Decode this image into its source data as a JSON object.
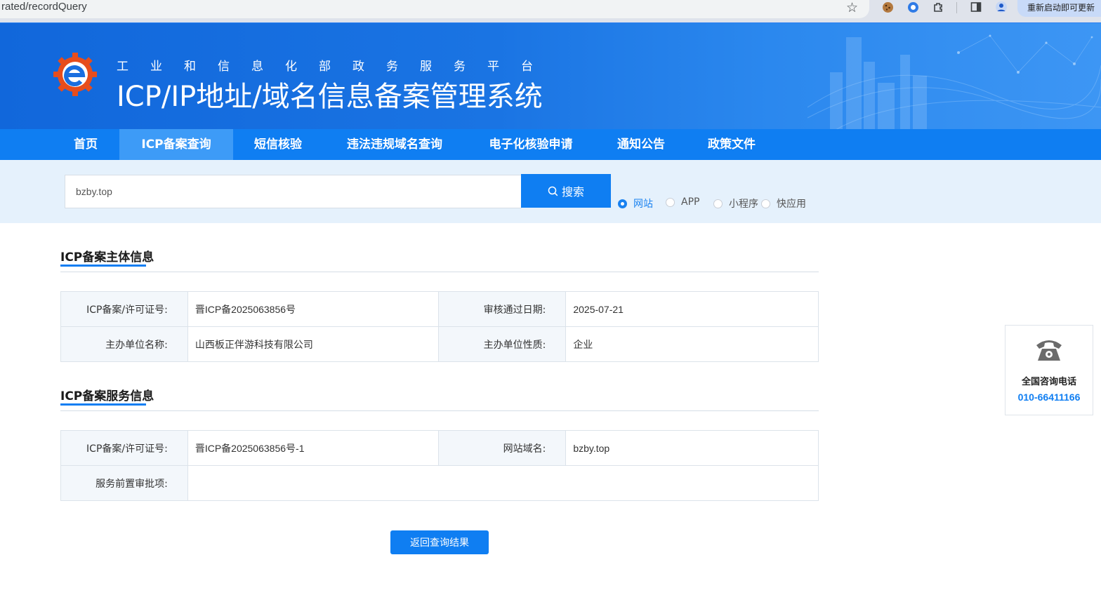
{
  "browser": {
    "url_text": "rated/recordQuery",
    "restart_label": "重新启动即可更新"
  },
  "header": {
    "subtitle": "工业和信息化部政务服务平台",
    "title": "ICP/IP地址/域名信息备案管理系统"
  },
  "nav": {
    "items": [
      {
        "label": "首页"
      },
      {
        "label": "ICP备案查询"
      },
      {
        "label": "短信核验"
      },
      {
        "label": "违法违规域名查询"
      },
      {
        "label": "电子化核验申请"
      },
      {
        "label": "通知公告"
      },
      {
        "label": "政策文件"
      }
    ],
    "active_index": 1
  },
  "search": {
    "value": "bzby.top",
    "button_label": "搜索",
    "types": [
      {
        "label": "网站",
        "selected": true
      },
      {
        "label": "APP",
        "selected": false
      },
      {
        "label": "小程序",
        "selected": false
      },
      {
        "label": "快应用",
        "selected": false
      }
    ]
  },
  "subject_info": {
    "title": "ICP备案主体信息",
    "rows": [
      {
        "label1": "ICP备案/许可证号:",
        "value1": "晋ICP备2025063856号",
        "label2": "审核通过日期:",
        "value2": "2025-07-21"
      },
      {
        "label1": "主办单位名称:",
        "value1": "山西板正伴游科技有限公司",
        "label2": "主办单位性质:",
        "value2": "企业"
      }
    ]
  },
  "service_info": {
    "title": "ICP备案服务信息",
    "license_label": "ICP备案/许可证号:",
    "license_value": "晋ICP备2025063856号-1",
    "domain_label": "网站域名:",
    "domain_value": "bzby.top",
    "approval_label": "服务前置审批项:",
    "approval_value": ""
  },
  "back_button_label": "返回查询结果",
  "hotline": {
    "label": "全国咨询电话",
    "number": "010-66411166"
  },
  "colors": {
    "primary": "#0f7ef2",
    "nav_active": "#3d9bf7",
    "search_bg": "#e5f1fc"
  }
}
